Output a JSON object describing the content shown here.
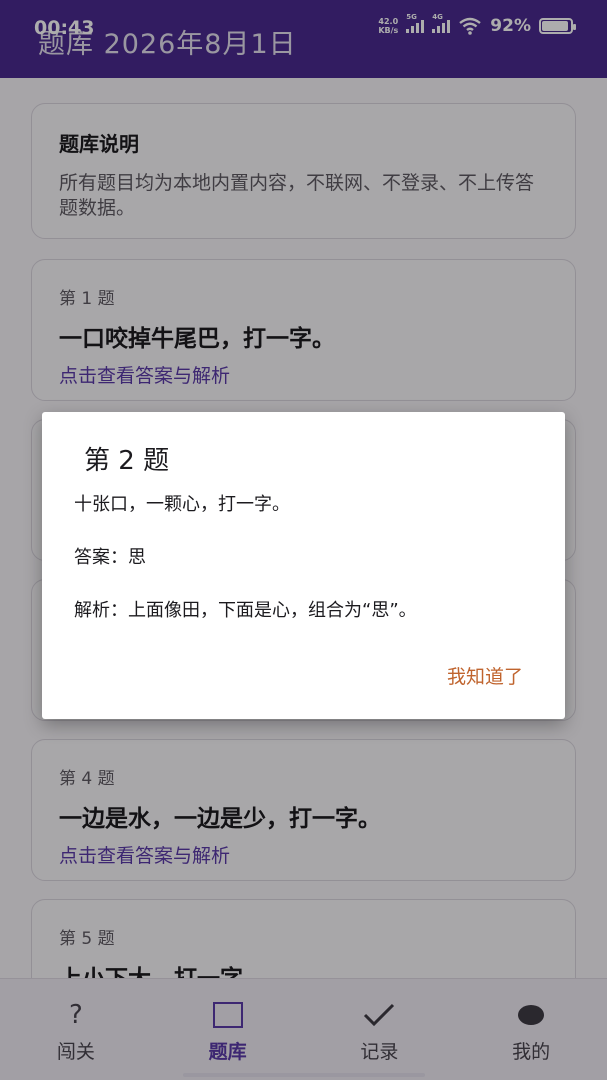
{
  "status_bar": {
    "time": "00:43",
    "net_speed_value": "42.0",
    "net_speed_unit": "KB/s",
    "sig1_label": "5G",
    "sig2_label": "4G",
    "battery_pct": "92%",
    "battery_level": 0.92
  },
  "app_bar": {
    "title": "题库  2026年8月1日"
  },
  "intro": {
    "title": "题库说明",
    "text": "所有题目均为本地内置内容，不联网、不登录、不上传答题数据。"
  },
  "questions": [
    {
      "num": "第 1 题",
      "text": "一口咬掉牛尾巴，打一字。",
      "link": "点击查看答案与解析"
    },
    {
      "num": "第 4 题",
      "text": "一边是水，一边是少，打一字。",
      "link": "点击查看答案与解析"
    },
    {
      "num": "第 5 题",
      "text": "上小下大，打一字。"
    }
  ],
  "dialog": {
    "title": "第 2 题",
    "question": "十张口，一颗心，打一字。",
    "answer": "答案：思",
    "explanation": "解析：上面像田，下面是心，组合为“思”。",
    "ok_label": "我知道了"
  },
  "nav": [
    {
      "label": "闯关",
      "icon": "question-mark-icon"
    },
    {
      "label": "题库",
      "icon": "square-icon",
      "active": true
    },
    {
      "label": "记录",
      "icon": "checkmark-icon"
    },
    {
      "label": "我的",
      "icon": "profile-dot-icon"
    }
  ],
  "colors": {
    "app_bar": "#4a2a8f",
    "accent": "#5b3aa8",
    "dialog_button": "#c0642e"
  }
}
